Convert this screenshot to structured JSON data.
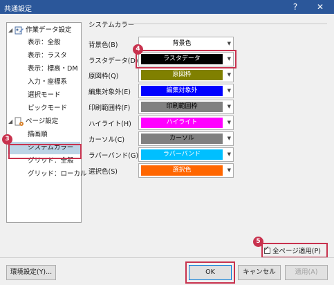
{
  "window": {
    "title": "共通設定",
    "help_label": "?",
    "close_label": "✕"
  },
  "tree": {
    "groups": [
      {
        "label": "作業データ設定",
        "icon": "work-data-settings-icon"
      },
      {
        "label": "ページ設定",
        "icon": "page-settings-icon"
      }
    ],
    "items": [
      {
        "label": "表示：全般"
      },
      {
        "label": "表示：ラスタ"
      },
      {
        "label": "表示：標高・DM"
      },
      {
        "label": "入力・座標系"
      },
      {
        "label": "選択モード"
      },
      {
        "label": "ピックモード"
      },
      {
        "label": "描画順"
      },
      {
        "label": "システムカラー"
      },
      {
        "label": "グリッド：全般"
      },
      {
        "label": "グリッド：ローカル"
      }
    ],
    "selected": "システムカラー"
  },
  "section": {
    "title": "システムカラー"
  },
  "colors": [
    {
      "label": "背景色(B)",
      "value": "背景色",
      "color": "#ffffff",
      "text_color": "#000000"
    },
    {
      "label": "ラスタデータ(D)",
      "value": "ラスタデータ",
      "color": "#000000",
      "text_color": "#ffffff"
    },
    {
      "label": "原図枠(Q)",
      "value": "原図枠",
      "color": "#808000",
      "text_color": "#ffffff"
    },
    {
      "label": "編集対象外(E)",
      "value": "編集対象外",
      "color": "#0000ff",
      "text_color": "#ffffff"
    },
    {
      "label": "印刷範囲枠(F)",
      "value": "印刷範囲枠",
      "color": "#808080",
      "text_color": "#000000"
    },
    {
      "label": "ハイライト(H)",
      "value": "ハイライト",
      "color": "#ff00ff",
      "text_color": "#ffffff"
    },
    {
      "label": "カーソル(C)",
      "value": "カーソル",
      "color": "#808080",
      "text_color": "#000000"
    },
    {
      "label": "ラバーバンド(G)",
      "value": "ラバーバンド",
      "color": "#00bfff",
      "text_color": "#ffffff"
    },
    {
      "label": "選択色(S)",
      "value": "選択色",
      "color": "#ff6600",
      "text_color": "#ffffff"
    }
  ],
  "apply_all": {
    "label": "全ページ適用(P)",
    "checked": true
  },
  "buttons": {
    "env": "環境設定(Y)...",
    "ok": "OK",
    "cancel": "キャンセル",
    "apply": "適用(A)"
  },
  "badges": {
    "tree": "3",
    "combo": "4",
    "checkbox": "5"
  },
  "accent": "#c8324e"
}
